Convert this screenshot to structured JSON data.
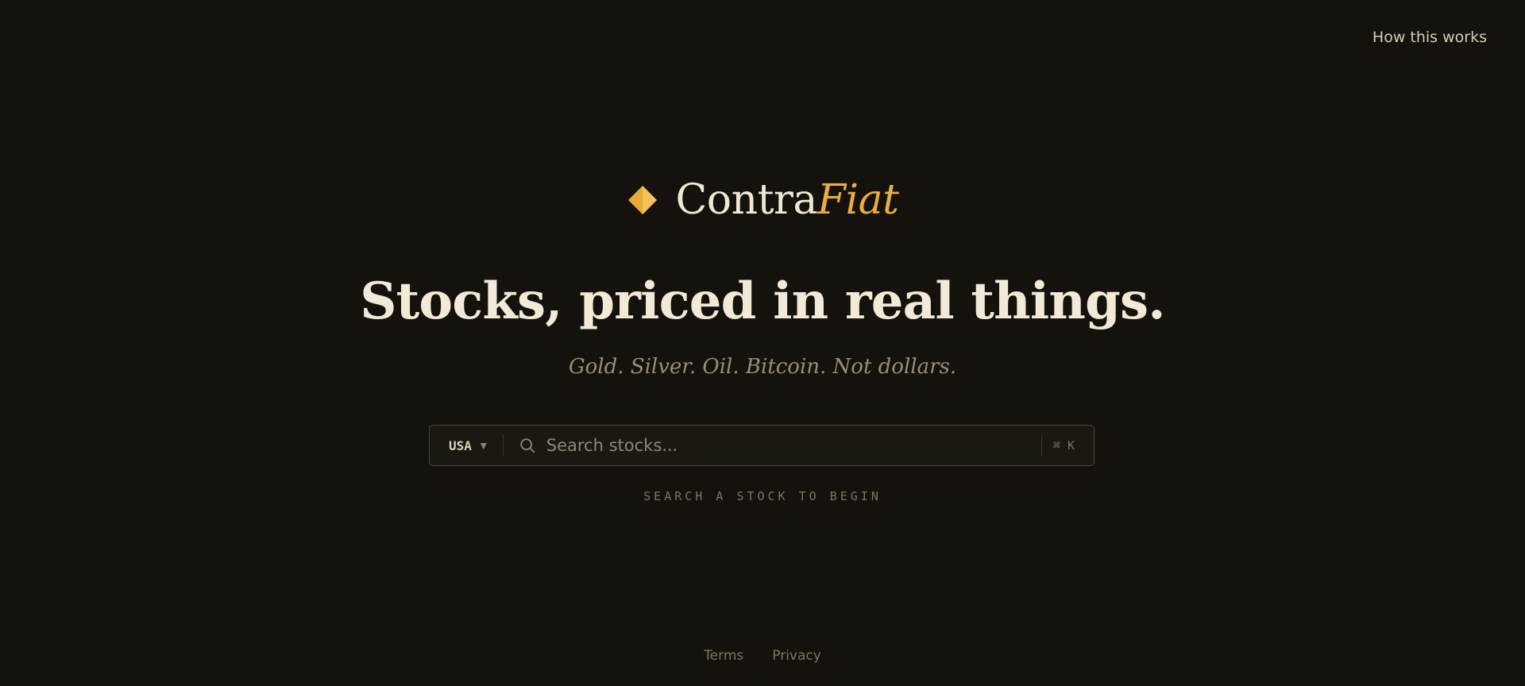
{
  "header": {
    "nav_link": "How this works"
  },
  "brand": {
    "name_primary": "Contra",
    "name_accent": "Fiat",
    "logo_icon": "diamond-icon",
    "accent_color": "#eaae3d"
  },
  "hero": {
    "headline": "Stocks, priced in real things.",
    "subheadline": "Gold. Silver. Oil. Bitcoin. Not dollars."
  },
  "search": {
    "market": "USA",
    "market_caret": "▼",
    "placeholder": "Search stocks...",
    "shortcut": "⌘ K",
    "hint": "SEARCH A STOCK TO BEGIN"
  },
  "footer": {
    "links": [
      "Terms",
      "Privacy"
    ]
  },
  "colors": {
    "background": "#15120d",
    "text_primary": "#f2ead6",
    "text_muted": "#998e7a"
  }
}
